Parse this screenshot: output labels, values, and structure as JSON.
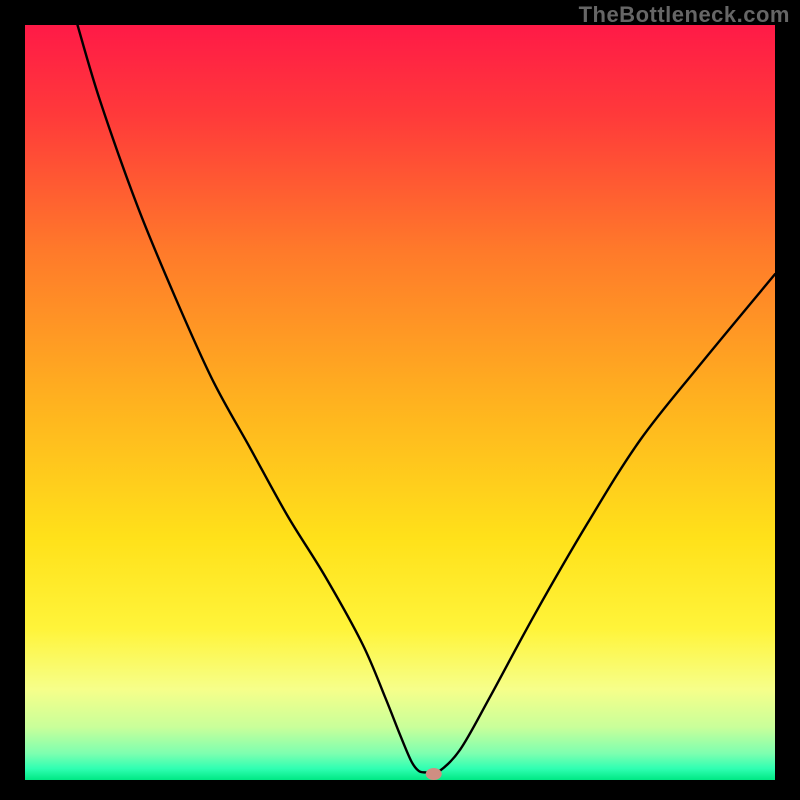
{
  "watermark": "TheBottleneck.com",
  "chart_data": {
    "type": "line",
    "title": "",
    "xlabel": "",
    "ylabel": "",
    "xlim": [
      0,
      100
    ],
    "ylim": [
      0,
      100
    ],
    "grid": false,
    "legend": false,
    "notes": "axes and tick labels are not displayed; background is a vertical red→orange→yellow→green gradient; a notch/marker sits at the curve minimum",
    "series": [
      {
        "name": "bottleneck-curve",
        "color": "#000000",
        "x": [
          7,
          10,
          15,
          20,
          25,
          30,
          35,
          40,
          45,
          48,
          50,
          51.5,
          52.5,
          53.5,
          55,
          58,
          62,
          68,
          75,
          82,
          90,
          100
        ],
        "y": [
          100,
          90,
          76,
          64,
          53,
          44,
          35,
          27,
          18,
          11,
          6,
          2.5,
          1.2,
          1.0,
          1.0,
          4,
          11,
          22,
          34,
          45,
          55,
          67
        ]
      }
    ],
    "marker": {
      "x": 54.5,
      "y": 0.8,
      "color": "#cf8e82"
    },
    "gradient_stops": [
      {
        "offset": 0.0,
        "color": "#ff1a47"
      },
      {
        "offset": 0.12,
        "color": "#ff3a3a"
      },
      {
        "offset": 0.3,
        "color": "#ff7a2a"
      },
      {
        "offset": 0.5,
        "color": "#ffb21f"
      },
      {
        "offset": 0.68,
        "color": "#ffe11a"
      },
      {
        "offset": 0.8,
        "color": "#fff43a"
      },
      {
        "offset": 0.88,
        "color": "#f6ff8a"
      },
      {
        "offset": 0.93,
        "color": "#c9ff9a"
      },
      {
        "offset": 0.965,
        "color": "#7dffb0"
      },
      {
        "offset": 0.985,
        "color": "#2fffb2"
      },
      {
        "offset": 1.0,
        "color": "#00e884"
      }
    ]
  }
}
